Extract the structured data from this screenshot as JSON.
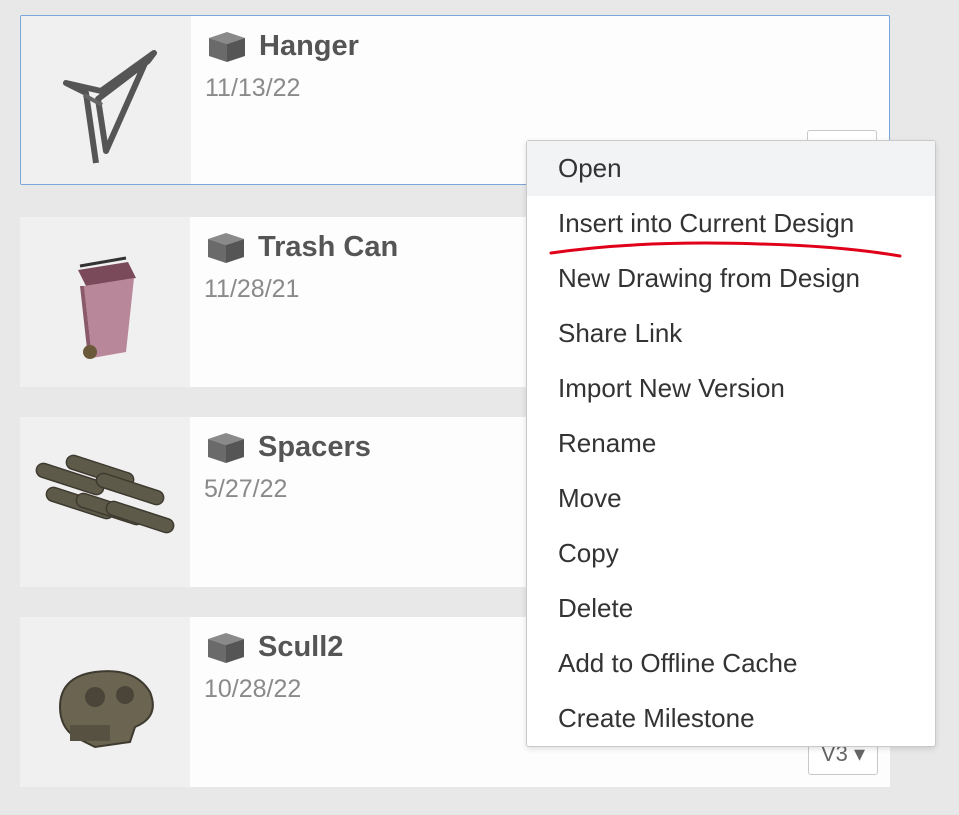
{
  "designs": [
    {
      "name": "Hanger",
      "date": "11/13/22",
      "version": ""
    },
    {
      "name": "Trash Can",
      "date": "11/28/21",
      "version": ""
    },
    {
      "name": "Spacers",
      "date": "5/27/22",
      "version": ""
    },
    {
      "name": "Scull2",
      "date": "10/28/22",
      "version": "V3 ▾"
    }
  ],
  "context_menu": {
    "items": [
      "Open",
      "Insert into Current Design",
      "New Drawing from Design",
      "Share Link",
      "Import New Version",
      "Rename",
      "Move",
      "Copy",
      "Delete",
      "Add to Offline Cache",
      "Create Milestone"
    ],
    "underlined_item": "Insert into Current Design"
  },
  "colors": {
    "selection_border": "#7aa6d9",
    "annotation_underline": "#e0001a",
    "title_text": "#555555",
    "date_text": "#8a8a8a"
  }
}
